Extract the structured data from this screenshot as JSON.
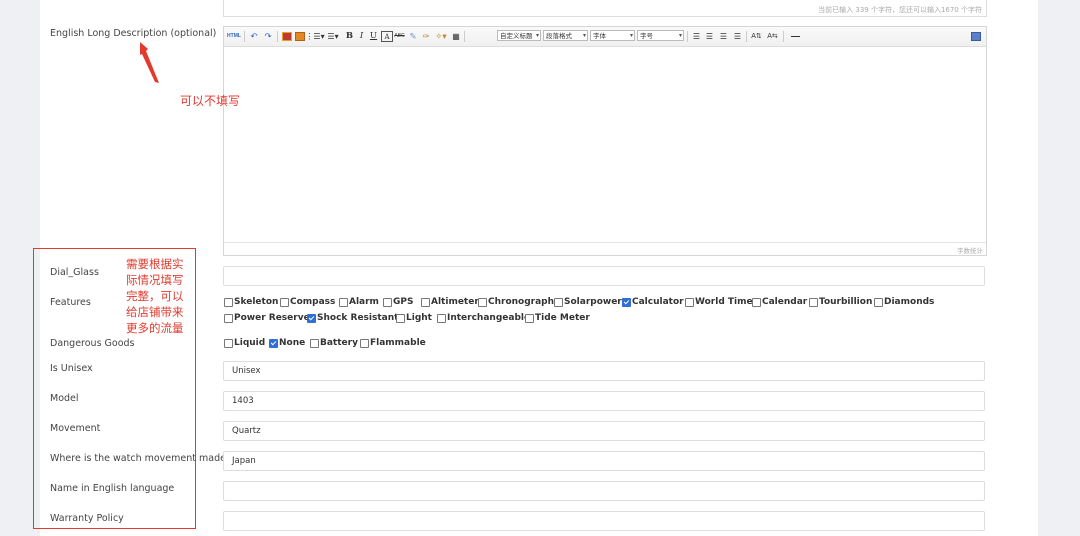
{
  "top": {
    "counter": "当前已输入 339 个字符，您还可以输入1670 个字符"
  },
  "long_desc": {
    "label": "English Long Description (optional)"
  },
  "editor": {
    "toolbar": {
      "html": "HTML",
      "bold": "B",
      "italic": "I",
      "underline": "U",
      "font_color": "A",
      "custom_heading": "自定义标题",
      "paragraph_format": "段落格式",
      "font_family": "字体",
      "font_size": "字号"
    },
    "word_count": "字数统计"
  },
  "annotations": {
    "optional_note": "可以不填写",
    "fill_note_lines": [
      "需要根据实",
      "际情况填写",
      "完整，可以",
      "给店铺带来",
      "更多的流量"
    ],
    "accent_color": "#e23a2e"
  },
  "fields": {
    "dial_glass": {
      "label": "Dial_Glass",
      "value": ""
    },
    "features": {
      "label": "Features",
      "options": [
        {
          "label": "Skeleton",
          "checked": false
        },
        {
          "label": "Compass",
          "checked": false
        },
        {
          "label": "Alarm",
          "checked": false
        },
        {
          "label": "GPS",
          "checked": false
        },
        {
          "label": "Altimeter",
          "checked": false
        },
        {
          "label": "Chronograph",
          "checked": false
        },
        {
          "label": "Solarpower",
          "checked": false
        },
        {
          "label": "Calculator",
          "checked": true
        },
        {
          "label": "World Time",
          "checked": false
        },
        {
          "label": "Calendar",
          "checked": false
        },
        {
          "label": "Tourbillion",
          "checked": false
        },
        {
          "label": "Diamonds",
          "checked": false
        },
        {
          "label": "Power Reserve",
          "checked": false
        },
        {
          "label": "Shock Resistant",
          "checked": true
        },
        {
          "label": "Light",
          "checked": false
        },
        {
          "label": "Interchangeable",
          "checked": false
        },
        {
          "label": "Tide Meter",
          "checked": false
        }
      ]
    },
    "dangerous_goods": {
      "label": "Dangerous Goods",
      "options": [
        {
          "label": "Liquid",
          "checked": false
        },
        {
          "label": "None",
          "checked": true
        },
        {
          "label": "Battery",
          "checked": false
        },
        {
          "label": "Flammable",
          "checked": false
        }
      ]
    },
    "is_unisex": {
      "label": "Is Unisex",
      "value": "Unisex"
    },
    "model": {
      "label": "Model",
      "value": "1403"
    },
    "movement": {
      "label": "Movement",
      "value": "Quartz"
    },
    "movement_origin": {
      "label": "Where is the watch movement made",
      "value": "Japan"
    },
    "name_english": {
      "label": "Name in English language",
      "value": ""
    },
    "warranty": {
      "label": "Warranty Policy",
      "value": ""
    }
  }
}
